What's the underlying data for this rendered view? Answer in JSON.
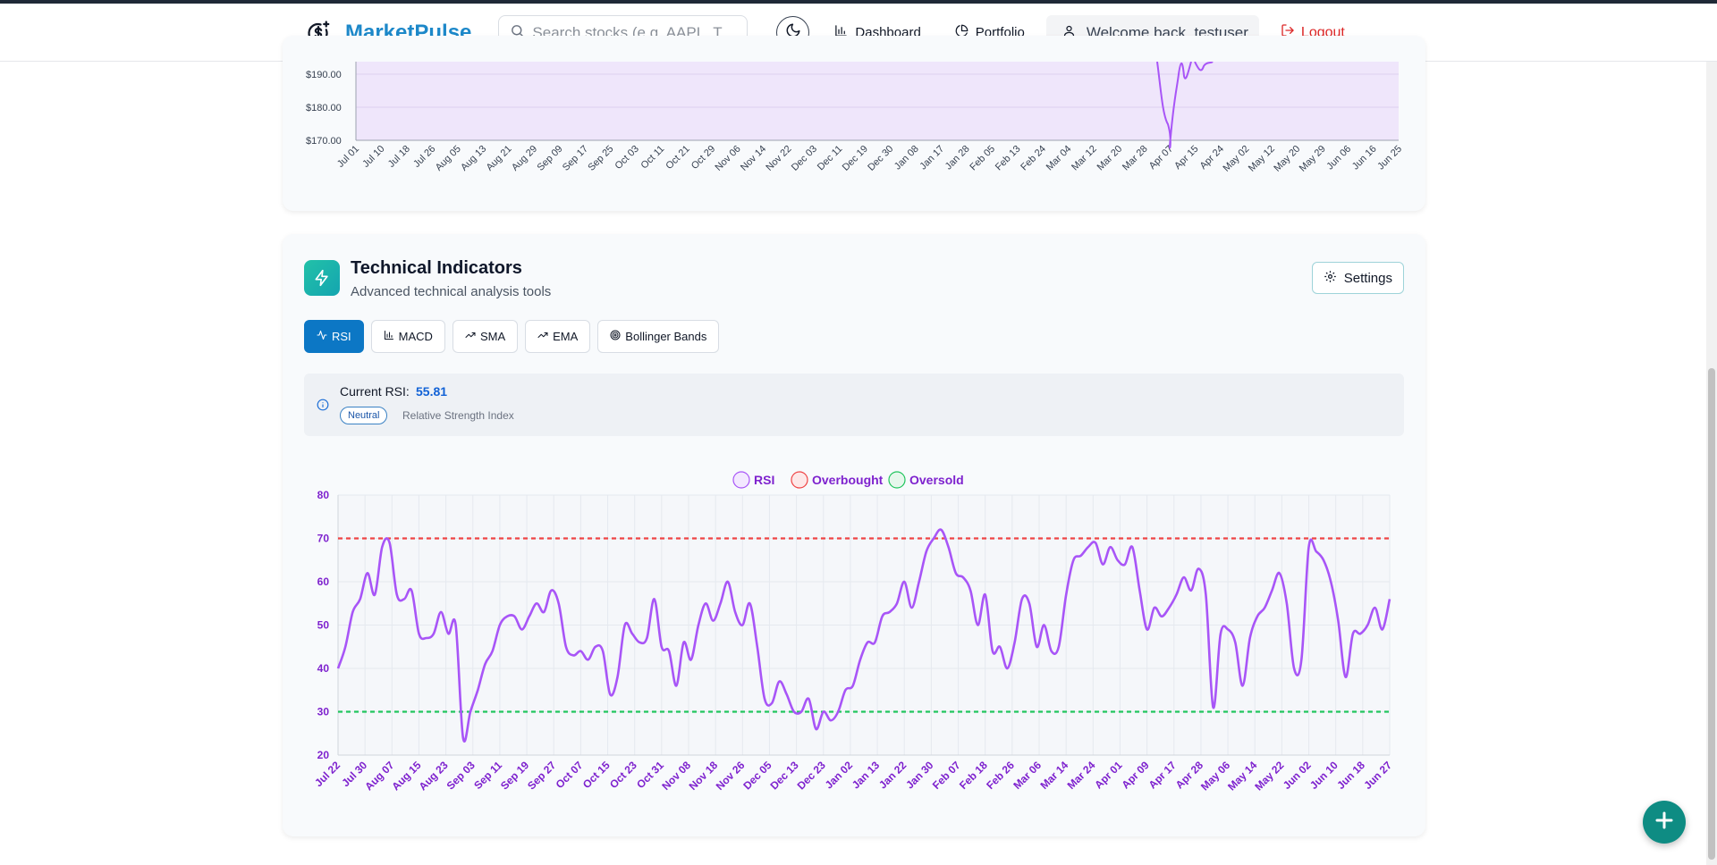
{
  "header": {
    "brand": "MarketPulse",
    "search_placeholder": "Search stocks (e.g. AAPL, T",
    "nav": {
      "dashboard": "Dashboard",
      "portfolio": "Portfolio"
    },
    "welcome": "Welcome back, testuser",
    "logout": "Logout"
  },
  "price_chart": {
    "y_ticks": [
      "$190.00",
      "$180.00",
      "$170.00"
    ],
    "x_ticks": [
      "Jul 01",
      "Jul 10",
      "Jul 18",
      "Jul 26",
      "Aug 05",
      "Aug 13",
      "Aug 21",
      "Aug 29",
      "Sep 09",
      "Sep 17",
      "Sep 25",
      "Oct 03",
      "Oct 11",
      "Oct 21",
      "Oct 29",
      "Nov 06",
      "Nov 14",
      "Nov 22",
      "Dec 03",
      "Dec 11",
      "Dec 19",
      "Dec 30",
      "Jan 08",
      "Jan 17",
      "Jan 28",
      "Feb 05",
      "Feb 13",
      "Feb 24",
      "Mar 04",
      "Mar 12",
      "Mar 20",
      "Mar 28",
      "Apr 07",
      "Apr 15",
      "Apr 24",
      "May 02",
      "May 12",
      "May 20",
      "May 29",
      "Jun 06",
      "Jun 16",
      "Jun 25"
    ],
    "line_color": "#a855f7",
    "fill_color": "#efe6fb"
  },
  "technical": {
    "title": "Technical Indicators",
    "subtitle": "Advanced technical analysis tools",
    "settings_label": "Settings",
    "tabs": [
      {
        "label": "RSI",
        "icon": "activity-icon",
        "active": true
      },
      {
        "label": "MACD",
        "icon": "bar-chart-icon",
        "active": false
      },
      {
        "label": "SMA",
        "icon": "trending-up-icon",
        "active": false
      },
      {
        "label": "EMA",
        "icon": "trending-up-icon",
        "active": false
      },
      {
        "label": "Bollinger Bands",
        "icon": "target-icon",
        "active": false
      }
    ],
    "rsi_label": "Current RSI:",
    "rsi_value": "55.81",
    "rsi_status": "Neutral",
    "rsi_description": "Relative Strength Index"
  },
  "chart_data": {
    "type": "line",
    "legend": [
      "RSI",
      "Overbought",
      "Oversold"
    ],
    "legend_position": "top-center",
    "colors": {
      "rsi": "#a855f7",
      "overbought": "#ef4444",
      "oversold": "#22c55e",
      "axis_text": "#7e22ce"
    },
    "ylim": [
      20,
      80
    ],
    "y_ticks": [
      80,
      70,
      60,
      50,
      40,
      30,
      20
    ],
    "overbought": 70,
    "oversold": 30,
    "x_ticks": [
      "Jul 22",
      "Jul 30",
      "Aug 07",
      "Aug 15",
      "Aug 23",
      "Sep 03",
      "Sep 11",
      "Sep 19",
      "Sep 27",
      "Oct 07",
      "Oct 15",
      "Oct 23",
      "Oct 31",
      "Nov 08",
      "Nov 18",
      "Nov 26",
      "Dec 05",
      "Dec 13",
      "Dec 23",
      "Jan 02",
      "Jan 13",
      "Jan 22",
      "Jan 30",
      "Feb 07",
      "Feb 18",
      "Feb 26",
      "Mar 06",
      "Mar 14",
      "Mar 24",
      "Apr 01",
      "Apr 09",
      "Apr 17",
      "Apr 28",
      "May 06",
      "May 14",
      "May 22",
      "Jun 02",
      "Jun 10",
      "Jun 18",
      "Jun 27"
    ],
    "series": [
      {
        "name": "RSI",
        "values": [
          40,
          45,
          53,
          56,
          62,
          57,
          68,
          69,
          57,
          56,
          58,
          48,
          47,
          48,
          53,
          48,
          50,
          24,
          30,
          35,
          41,
          44,
          50,
          52,
          52,
          49,
          52,
          55,
          53,
          58,
          55,
          45,
          43,
          44,
          42,
          45,
          44,
          34,
          38,
          50,
          48,
          46,
          47,
          56,
          45,
          44,
          36,
          46,
          42,
          50,
          55,
          51,
          55,
          60,
          53,
          50,
          55,
          45,
          33,
          32,
          37,
          34,
          30,
          30,
          33,
          26,
          30,
          28,
          30,
          35,
          36,
          42,
          46,
          46,
          52,
          53,
          55,
          60,
          54,
          60,
          67,
          70,
          72,
          68,
          62,
          61,
          58,
          50,
          57,
          44,
          45,
          40,
          46,
          56,
          55,
          45,
          50,
          44,
          45,
          57,
          65,
          66,
          68,
          69,
          64,
          68,
          65,
          64,
          68,
          58,
          49,
          54,
          52,
          54,
          57,
          61,
          58,
          63,
          57,
          31,
          48,
          49,
          46,
          36,
          47,
          52,
          54,
          58,
          62,
          55,
          40,
          42,
          68,
          67,
          65,
          60,
          51,
          38,
          48,
          48,
          50,
          54,
          49,
          56
        ]
      }
    ]
  }
}
